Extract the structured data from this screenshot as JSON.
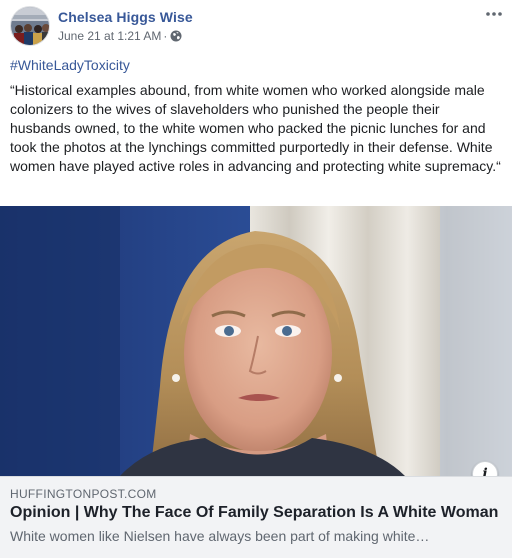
{
  "post": {
    "author": "Chelsea Higgs Wise",
    "timestamp": "June 21 at 1:21 AM",
    "separator": "·",
    "privacy_icon": "globe-icon",
    "more_icon": "more-options-icon",
    "hashtag": "#WhiteLadyToxicity",
    "text": "“Historical examples abound, from white women who worked alongside male colonizers to the wives of slaveholders who punished the people their husbands owned, to the white women who packed the picnic lunches for and took the photos at the lynchings committed purportedly in their defense. White women have played active roles in advancing and protecting white supremacy.“"
  },
  "link_preview": {
    "domain": "HUFFINGTONPOST.COM",
    "title": "Opinion | Why The Face Of Family Separation Is A White Woman",
    "description": "White women like Nielsen have always been part of making white…",
    "info_icon": "info-icon",
    "info_label": "i"
  },
  "colors": {
    "author_link": "#385898",
    "meta_text": "#606770",
    "link_box_bg": "#f2f3f5",
    "body_text": "#1c1e21"
  }
}
